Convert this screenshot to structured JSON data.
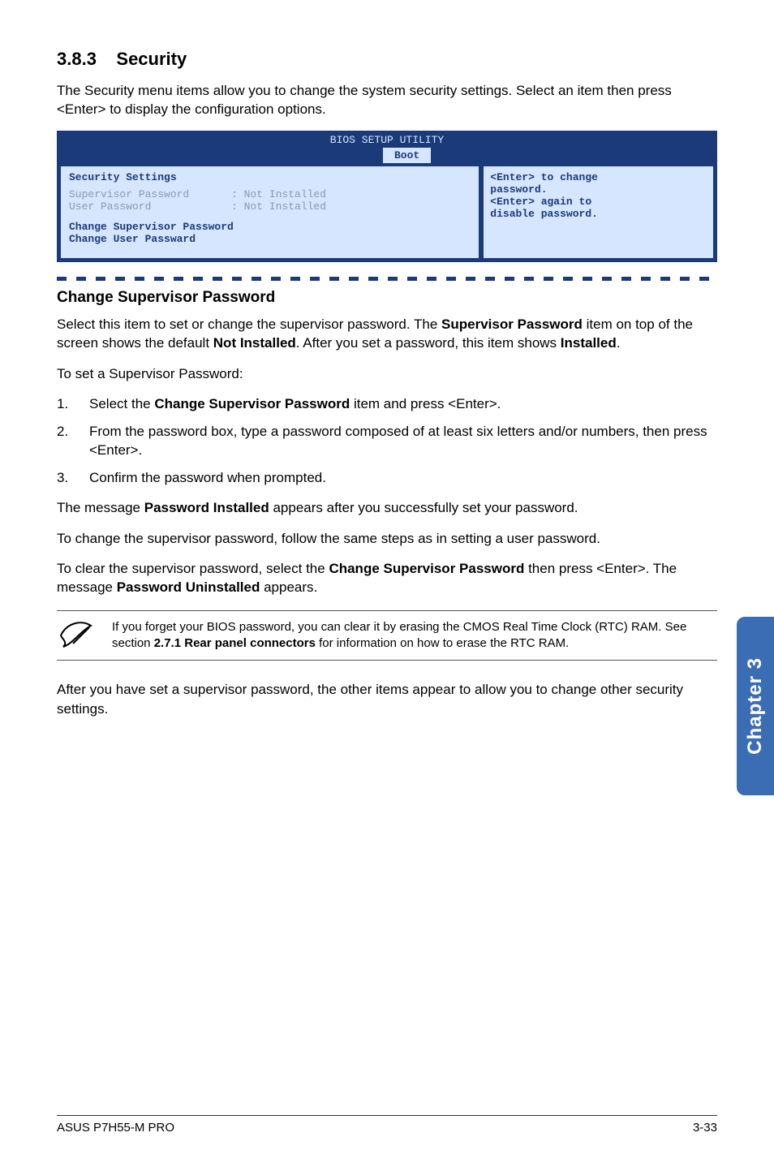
{
  "section": {
    "number": "3.8.3",
    "title": "Security"
  },
  "intro": "The Security menu items allow you to change the system security settings. Select an item then press <Enter> to display the configuration options.",
  "bios": {
    "title": "BIOS SETUP UTILITY",
    "tab": "Boot",
    "panel_heading": "Security Settings",
    "rows": [
      {
        "label": "Supervisor Password",
        "value": ": Not Installed"
      },
      {
        "label": "User Password",
        "value": ": Not Installed"
      }
    ],
    "actions": [
      "Change Supervisor Password",
      "Change User Passward"
    ],
    "help": {
      "line1": "<Enter> to change",
      "line2": "password.",
      "line3": "<Enter> again to",
      "line4": "disable password."
    }
  },
  "subheading": "Change Supervisor Password",
  "para1_a": "Select this item to set or change the supervisor password. The ",
  "para1_b": "Supervisor Password",
  "para1_c": " item on top of the screen shows the default ",
  "para1_d": "Not Installed",
  "para1_e": ". After you set a password, this item shows ",
  "para1_f": "Installed",
  "para1_g": ".",
  "para2": "To set a Supervisor Password:",
  "steps": [
    {
      "n": "1.",
      "a": "Select the ",
      "b": "Change Supervisor Password",
      "c": " item and press <Enter>."
    },
    {
      "n": "2.",
      "a": "From the password box, type a password composed of at least six letters and/or numbers, then press <Enter>.",
      "b": "",
      "c": ""
    },
    {
      "n": "3.",
      "a": "Confirm the password when prompted.",
      "b": "",
      "c": ""
    }
  ],
  "para3_a": "The message ",
  "para3_b": "Password Installed",
  "para3_c": " appears after you successfully set your password.",
  "para4": "To change the supervisor password, follow the same steps as in setting a user password.",
  "para5_a": "To clear the supervisor password, select the ",
  "para5_b": "Change Supervisor Password",
  "para5_c": " then press <Enter>. The message ",
  "para5_d": "Password Uninstalled",
  "para5_e": " appears.",
  "note_a": "If you forget your BIOS password, you can clear it by erasing the CMOS Real Time Clock (RTC) RAM. See section ",
  "note_b": "2.7.1 Rear panel connectors",
  "note_c": " for information on how to erase the RTC RAM.",
  "para6": "After you have set a supervisor password, the other items appear to allow you to change other security settings.",
  "side_tab": "Chapter 3",
  "footer_left": "ASUS P7H55-M PRO",
  "footer_right": "3-33"
}
